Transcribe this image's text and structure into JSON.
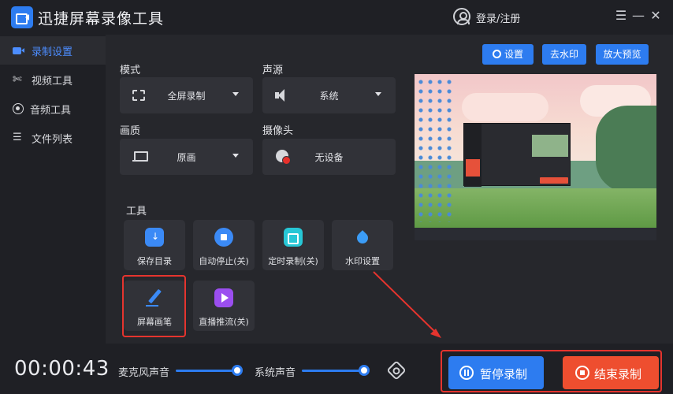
{
  "app": {
    "title": "迅捷屏幕录像工具",
    "login": "登录/注册"
  },
  "window": {
    "menu": "☰",
    "minimize": "—",
    "close": "✕"
  },
  "sidebar": {
    "items": [
      {
        "label": "录制设置",
        "icon": "video-camera-icon",
        "active": true
      },
      {
        "label": "视频工具",
        "icon": "tools-icon"
      },
      {
        "label": "音频工具",
        "icon": "audio-icon"
      },
      {
        "label": "文件列表",
        "icon": "list-icon"
      }
    ]
  },
  "settings": {
    "mode": {
      "label": "模式",
      "value": "全屏录制"
    },
    "audio_source": {
      "label": "声源",
      "value": "系统"
    },
    "quality": {
      "label": "画质",
      "value": "原画"
    },
    "camera": {
      "label": "摄像头",
      "value": "无设备"
    }
  },
  "tools": {
    "heading": "工具",
    "items": [
      {
        "label": "保存目录",
        "icon": "folder-download-icon"
      },
      {
        "label": "自动停止(关)",
        "icon": "stop-circle-icon"
      },
      {
        "label": "定时录制(关)",
        "icon": "timer-camera-icon"
      },
      {
        "label": "水印设置",
        "icon": "water-drop-icon"
      },
      {
        "label": "屏幕画笔",
        "icon": "brush-pen-icon"
      },
      {
        "label": "直播推流(关)",
        "icon": "live-stream-icon"
      }
    ]
  },
  "top_buttons": {
    "settings": "设置",
    "watermark_remove": "去水印",
    "enlarge_preview": "放大预览"
  },
  "bottom": {
    "timer": "00:00:43",
    "mic_label": "麦克风声音",
    "system_label": "系统声音",
    "pause": "暂停录制",
    "end": "结束录制"
  },
  "colors": {
    "accent": "#2d7cf0",
    "danger": "#ee4e2f",
    "highlight": "#e5342e"
  }
}
